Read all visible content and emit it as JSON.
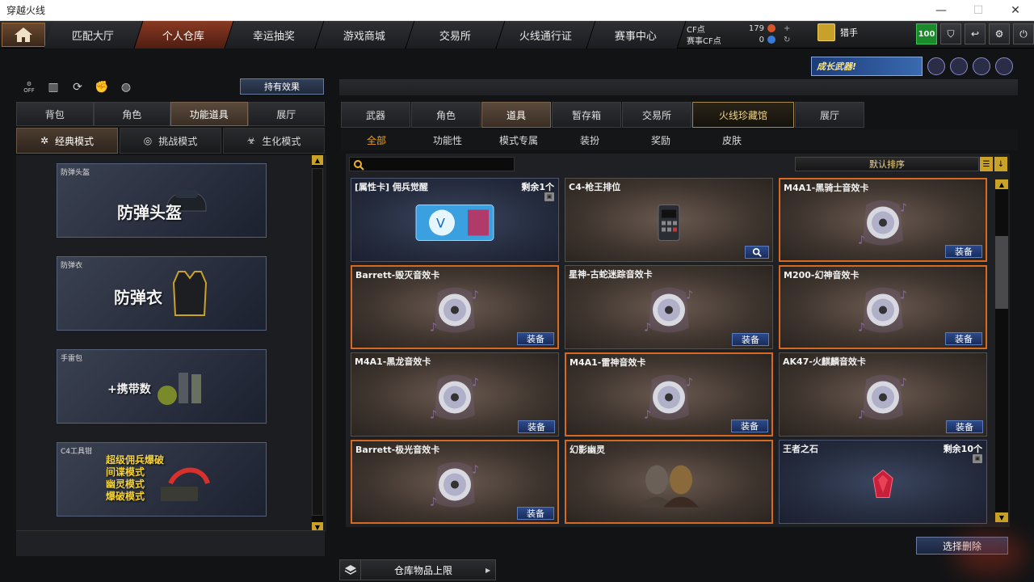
{
  "window": {
    "title": "穿越火线",
    "minimize": "—",
    "maximize": "☐",
    "close": "✕"
  },
  "nav": {
    "tabs": [
      "匹配大厅",
      "个人仓库",
      "幸运抽奖",
      "游戏商城",
      "交易所",
      "火线通行证",
      "赛事中心"
    ],
    "active_index": 1
  },
  "currency": {
    "cf_label": "CF点",
    "cf_value": "179",
    "match_cf_label": "赛事CF点",
    "match_cf_value": "0"
  },
  "user": {
    "name": "猎手"
  },
  "top_icons": {
    "level": "100"
  },
  "promo": {
    "banner_text": "成长武器!"
  },
  "left": {
    "hold_effect_label": "持有效果",
    "off_label": "OFF",
    "category_tabs": [
      "背包",
      "角色",
      "功能道具",
      "展厅"
    ],
    "category_active": 2,
    "mode_tabs": [
      "经典模式",
      "挑战模式",
      "生化模式"
    ],
    "mode_active": 0,
    "slots": [
      {
        "label": "防弹头盔",
        "text": "防弹头盔"
      },
      {
        "label": "防弹衣",
        "text": "防弹衣"
      },
      {
        "label": "手雷包",
        "text": "+携带数"
      },
      {
        "label": "C4工具钳",
        "lines": [
          "超级佣兵爆破",
          "间谍模式",
          "幽灵模式",
          "爆破模式"
        ]
      }
    ]
  },
  "main_tabs": [
    "武器",
    "角色",
    "道具",
    "暂存箱",
    "交易所",
    "火线珍藏馆",
    "展厅"
  ],
  "main_active": 2,
  "sub_tabs": [
    "全部",
    "功能性",
    "模式专属",
    "装扮",
    "奖励",
    "皮肤"
  ],
  "sub_active": 0,
  "sort_label": "默认排序",
  "equip_label": "装备",
  "cards": [
    {
      "title": "[属性卡] 佣兵觉醒",
      "remain": "剩余1个",
      "style": "blue",
      "kind": "ticket"
    },
    {
      "title": "C4-枪王排位",
      "style": "brown",
      "kind": "c4",
      "button": "search"
    },
    {
      "title": "M4A1-黑骑士音效卡",
      "style": "orange",
      "kind": "disc"
    },
    {
      "title": "Barrett-毁灭音效卡",
      "style": "orange",
      "kind": "disc"
    },
    {
      "title": "星神-古蛇迷踪音效卡",
      "style": "brown",
      "kind": "disc"
    },
    {
      "title": "M200-幻神音效卡",
      "style": "orange",
      "kind": "disc"
    },
    {
      "title": "M4A1-黑龙音效卡",
      "style": "brown",
      "kind": "disc"
    },
    {
      "title": "M4A1-雷神音效卡",
      "style": "orange",
      "kind": "disc"
    },
    {
      "title": "AK47-火麒麟音效卡",
      "style": "brown",
      "kind": "disc"
    },
    {
      "title": "Barrett-极光音效卡",
      "style": "orange",
      "kind": "disc"
    },
    {
      "title": "幻影幽灵",
      "style": "orange",
      "kind": "ghost"
    },
    {
      "title": "王者之石",
      "remain": "剩余10个",
      "style": "blue",
      "kind": "gem"
    }
  ],
  "select_delete_label": "选择删除",
  "warehouse_limit_label": "仓库物品上限",
  "icons": {
    "home": "home-icon",
    "search": "search-icon",
    "list": "list-icon",
    "sort": "sort-arrow-icon",
    "disc": "music-disc-icon",
    "lock": "lock-icon"
  }
}
